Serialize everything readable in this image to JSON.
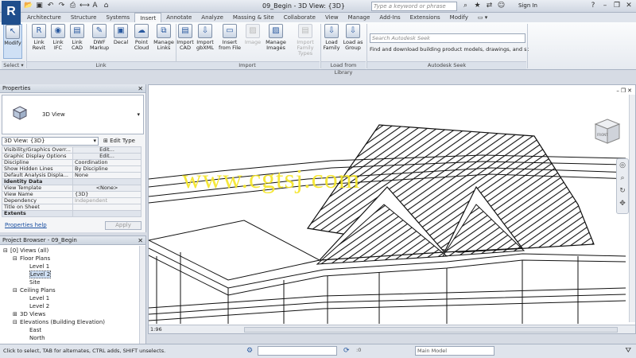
{
  "app": {
    "logo_letter": "R",
    "document_title": "09_Begin - 3D View: {3D}"
  },
  "titlebar": {
    "search_placeholder": "Type a keyword or phrase",
    "sign_in": "Sign In",
    "qat_icons": [
      "open-icon",
      "save-icon",
      "undo-icon",
      "redo-icon",
      "print-icon",
      "measure-icon",
      "text-icon",
      "3d-view-icon"
    ],
    "right_icons": [
      "binoculars-icon",
      "subscription-icon",
      "exchange-icon",
      "user-icon",
      "help-icon"
    ]
  },
  "tabs": [
    "Architecture",
    "Structure",
    "Systems",
    "Insert",
    "Annotate",
    "Analyze",
    "Massing & Site",
    "Collaborate",
    "View",
    "Manage",
    "Add-Ins",
    "Extensions",
    "Modify",
    "▭ ▾"
  ],
  "active_tab_index": 3,
  "ribbon": {
    "buttons": [
      {
        "label": "Modify",
        "icon": "cursor-icon",
        "glyph": "↖",
        "enabled": true
      },
      {
        "label": "Link\nRevit",
        "icon": "link-revit-icon",
        "glyph": "R",
        "enabled": true
      },
      {
        "label": "Link\nIFC",
        "icon": "link-ifc-icon",
        "glyph": "◉",
        "enabled": true
      },
      {
        "label": "Link\nCAD",
        "icon": "link-cad-icon",
        "glyph": "▤",
        "enabled": true
      },
      {
        "label": "DWF\nMarkup",
        "icon": "dwf-icon",
        "glyph": "✎",
        "enabled": true
      },
      {
        "label": "Decal",
        "icon": "decal-icon",
        "glyph": "▣",
        "enabled": true
      },
      {
        "label": "Point\nCloud",
        "icon": "point-cloud-icon",
        "glyph": "☁",
        "enabled": true
      },
      {
        "label": "Manage\nLinks",
        "icon": "manage-links-icon",
        "glyph": "⧉",
        "enabled": true
      },
      {
        "label": "Import\nCAD",
        "icon": "import-cad-icon",
        "glyph": "▤",
        "enabled": true
      },
      {
        "label": "Import\ngbXML",
        "icon": "import-gbxml-icon",
        "glyph": "⇩",
        "enabled": true
      },
      {
        "label": "Insert\nfrom File",
        "icon": "insert-file-icon",
        "glyph": "▭",
        "enabled": true
      },
      {
        "label": "Image",
        "icon": "image-icon",
        "glyph": "▨",
        "enabled": false
      },
      {
        "label": "Manage\nImages",
        "icon": "manage-images-icon",
        "glyph": "▨",
        "enabled": true
      },
      {
        "label": "Import\nFamily Types",
        "icon": "import-family-types-icon",
        "glyph": "▤",
        "enabled": false
      },
      {
        "label": "Load\nFamily",
        "icon": "load-family-icon",
        "glyph": "⇩",
        "enabled": true
      },
      {
        "label": "Load as\nGroup",
        "icon": "load-group-icon",
        "glyph": "⇩",
        "enabled": true
      }
    ],
    "panels": [
      "Select ▾",
      "Link",
      "Import",
      "Load from Library",
      "Autodesk Seek"
    ],
    "seek_placeholder": "Search Autodesk Seek",
    "seek_text": "Find and download building product models, drawings, and specs"
  },
  "properties": {
    "title": "Properties",
    "type_name": "3D View",
    "view_selector": "3D View: {3D}",
    "edit_type": "Edit Type",
    "rows": [
      {
        "name": "Visibility/Graphics Overr...",
        "value": "Edit...",
        "kind": "button"
      },
      {
        "name": "Graphic Display Options",
        "value": "Edit...",
        "kind": "button"
      },
      {
        "name": "Discipline",
        "value": "Coordination",
        "kind": "text"
      },
      {
        "name": "Show Hidden Lines",
        "value": "By Discipline",
        "kind": "text"
      },
      {
        "name": "Default Analysis Displa...",
        "value": "None",
        "kind": "text"
      },
      {
        "name": "Identity Data",
        "value": "",
        "kind": "group"
      },
      {
        "name": "View Template",
        "value": "<None>",
        "kind": "button"
      },
      {
        "name": "View Name",
        "value": "{3D}",
        "kind": "text"
      },
      {
        "name": "Dependency",
        "value": "Independent",
        "kind": "muted"
      },
      {
        "name": "Title on Sheet",
        "value": "",
        "kind": "text"
      },
      {
        "name": "Extents",
        "value": "",
        "kind": "group"
      }
    ],
    "help_link": "Properties help",
    "apply": "Apply"
  },
  "browser": {
    "title": "Project Browser - 09_Begin",
    "tree": [
      {
        "text": "[0] Views (all)",
        "depth": 0,
        "toggle": "⊟"
      },
      {
        "text": "Floor Plans",
        "depth": 1,
        "toggle": "⊟"
      },
      {
        "text": "Level 1",
        "depth": 2,
        "toggle": ""
      },
      {
        "text": "Level 2",
        "depth": 2,
        "toggle": "",
        "selected": true
      },
      {
        "text": "Site",
        "depth": 2,
        "toggle": ""
      },
      {
        "text": "Ceiling Plans",
        "depth": 1,
        "toggle": "⊟"
      },
      {
        "text": "Level 1",
        "depth": 2,
        "toggle": ""
      },
      {
        "text": "Level 2",
        "depth": 2,
        "toggle": ""
      },
      {
        "text": "3D Views",
        "depth": 1,
        "toggle": "⊞"
      },
      {
        "text": "Elevations (Building Elevation)",
        "depth": 1,
        "toggle": "⊟"
      },
      {
        "text": "East",
        "depth": 2,
        "toggle": ""
      },
      {
        "text": "North",
        "depth": 2,
        "toggle": ""
      }
    ]
  },
  "viewport": {
    "watermark": "www.cgtsj.com",
    "scale": "1:96",
    "cube_label": "FRONT"
  },
  "statusbar": {
    "hint": "Click to select, TAB for alternates, CTRL adds, SHIFT unselects.",
    "workset_value": ":0",
    "model": "Main Model"
  },
  "colors": {
    "accent": "#1f4e8c",
    "watermark": "#f5e62a",
    "roof_hatch": "#111111"
  }
}
